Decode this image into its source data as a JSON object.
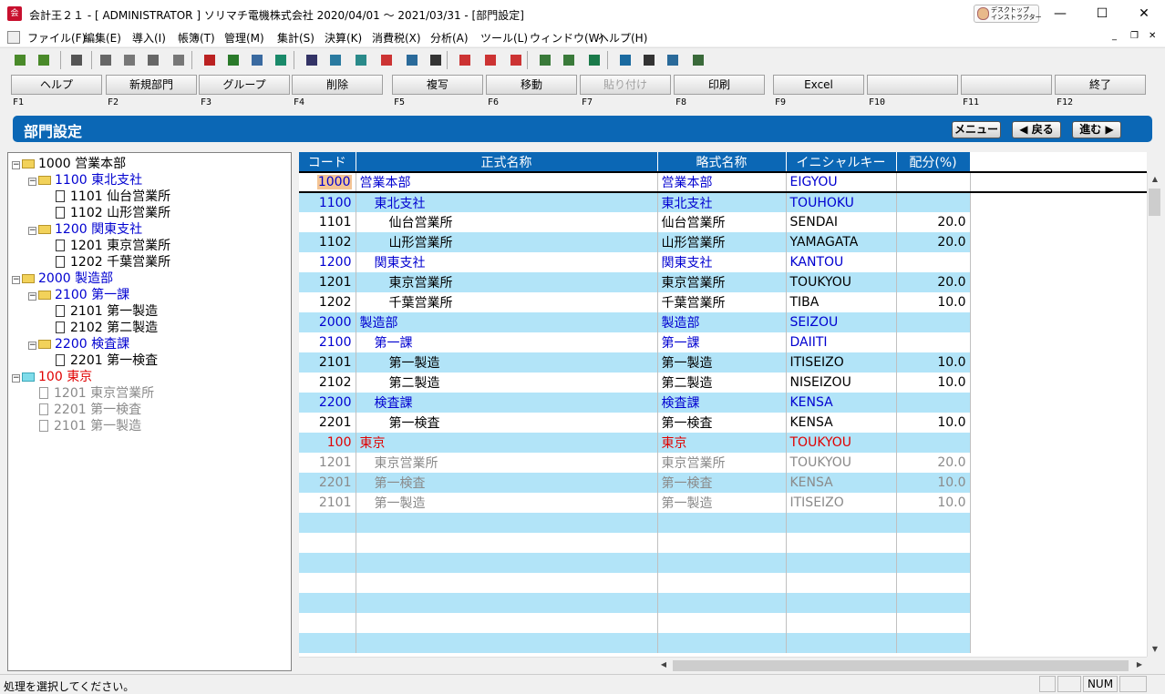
{
  "window": {
    "app_icon": "会",
    "title": "会計王２１ - [ ADMINISTRATOR ] ソリマチ電機株式会社 2020/04/01 〜 2021/03/31 - [部門設定]",
    "desktop_instructor": [
      "デスクトップ",
      "インストラクター"
    ],
    "minimize": "—",
    "maximize": "☐",
    "close": "✕"
  },
  "menu": [
    "ファイル(F)",
    "編集(E)",
    "導入(I)",
    "帳簿(T)",
    "管理(M)",
    "集計(S)",
    "決算(K)",
    "消費税(X)",
    "分析(A)",
    "ツール(L)",
    "ウィンドウ(W)",
    "ヘルプ(H)"
  ],
  "mdi_controls": [
    "_",
    "❐",
    "✕"
  ],
  "toolbar_icons": [
    "import-icon",
    "export-icon",
    "select-icon",
    "cut-icon",
    "copy-icon",
    "paste-icon",
    "clipboard-icon",
    "book-icon",
    "ledger-icon",
    "journal-icon",
    "heart-icon",
    "easy-entry-icon",
    "keyboard-icon",
    "bank-icon",
    "exp-icon",
    "transfer-icon",
    "calendar-icon",
    "stop-icon",
    "schedule-icon",
    "delete-schedule-icon",
    "report-icon",
    "report2-icon",
    "excel-icon",
    "help-icon",
    "layers-icon",
    "globe-icon",
    "calculator-icon"
  ],
  "fkeys": [
    {
      "label": "ヘルプ",
      "key": "F1",
      "enabled": true
    },
    {
      "label": "新規部門",
      "key": "F2",
      "enabled": true
    },
    {
      "label": "グループ",
      "key": "F3",
      "enabled": true
    },
    {
      "label": "削除",
      "key": "F4",
      "enabled": true
    },
    {
      "label": "複写",
      "key": "F5",
      "enabled": true
    },
    {
      "label": "移動",
      "key": "F6",
      "enabled": true
    },
    {
      "label": "貼り付け",
      "key": "F7",
      "enabled": false
    },
    {
      "label": "印刷",
      "key": "F8",
      "enabled": true
    },
    {
      "label": "Excel",
      "key": "F9",
      "enabled": true
    },
    {
      "label": "",
      "key": "F10",
      "enabled": true
    },
    {
      "label": "",
      "key": "F11",
      "enabled": true
    },
    {
      "label": "終了",
      "key": "F12",
      "enabled": true
    }
  ],
  "section": {
    "title": "部門設定",
    "menu_btn": "メニュー",
    "back_btn": "◀ 戻る",
    "next_btn": "進む ▶"
  },
  "tree": [
    {
      "level": 0,
      "kind": "folder",
      "expander": "−",
      "code": "1000",
      "name": "営業本部",
      "color": "blk"
    },
    {
      "level": 1,
      "kind": "folder",
      "expander": "−",
      "code": "1100",
      "name": "東北支社",
      "color": "blue"
    },
    {
      "level": 2,
      "kind": "doc",
      "expander": "",
      "code": "1101",
      "name": "仙台営業所",
      "color": "blk"
    },
    {
      "level": 2,
      "kind": "doc",
      "expander": "",
      "code": "1102",
      "name": "山形営業所",
      "color": "blk"
    },
    {
      "level": 1,
      "kind": "folder",
      "expander": "−",
      "code": "1200",
      "name": "関東支社",
      "color": "blue"
    },
    {
      "level": 2,
      "kind": "doc",
      "expander": "",
      "code": "1201",
      "name": "東京営業所",
      "color": "blk"
    },
    {
      "level": 2,
      "kind": "doc",
      "expander": "",
      "code": "1202",
      "name": "千葉営業所",
      "color": "blk"
    },
    {
      "level": 0,
      "kind": "folder",
      "expander": "−",
      "code": "2000",
      "name": "製造部",
      "color": "blue"
    },
    {
      "level": 1,
      "kind": "folder",
      "expander": "−",
      "code": "2100",
      "name": "第一課",
      "color": "blue"
    },
    {
      "level": 2,
      "kind": "doc",
      "expander": "",
      "code": "2101",
      "name": "第一製造",
      "color": "blk"
    },
    {
      "level": 2,
      "kind": "doc",
      "expander": "",
      "code": "2102",
      "name": "第二製造",
      "color": "blk"
    },
    {
      "level": 1,
      "kind": "folder",
      "expander": "−",
      "code": "2200",
      "name": "検査課",
      "color": "blue"
    },
    {
      "level": 2,
      "kind": "doc",
      "expander": "",
      "code": "2201",
      "name": "第一検査",
      "color": "blk"
    },
    {
      "level": 0,
      "kind": "cyanfolder",
      "expander": "−",
      "code": "100",
      "name": "東京",
      "color": "red"
    },
    {
      "level": 1,
      "kind": "docgray",
      "expander": "",
      "code": "1201",
      "name": "東京営業所",
      "color": "gray"
    },
    {
      "level": 1,
      "kind": "docgray",
      "expander": "",
      "code": "2201",
      "name": "第一検査",
      "color": "gray"
    },
    {
      "level": 1,
      "kind": "docgray",
      "expander": "",
      "code": "2101",
      "name": "第一製造",
      "color": "gray"
    }
  ],
  "grid": {
    "headers": [
      "コード",
      "正式名称",
      "略式名称",
      "イニシャルキー",
      "配分(%)"
    ],
    "rows": [
      {
        "code": "1000",
        "name": "営業本部",
        "indent": 0,
        "short": "営業本部",
        "key": "EIGYOU",
        "pct": "",
        "color": "blue",
        "selected": true
      },
      {
        "code": "1100",
        "name": "東北支社",
        "indent": 1,
        "short": "東北支社",
        "key": "TOUHOKU",
        "pct": "",
        "color": "blue"
      },
      {
        "code": "1101",
        "name": "仙台営業所",
        "indent": 2,
        "short": "仙台営業所",
        "key": "SENDAI",
        "pct": "20.0",
        "color": "blk"
      },
      {
        "code": "1102",
        "name": "山形営業所",
        "indent": 2,
        "short": "山形営業所",
        "key": "YAMAGATA",
        "pct": "20.0",
        "color": "blk"
      },
      {
        "code": "1200",
        "name": "関東支社",
        "indent": 1,
        "short": "関東支社",
        "key": "KANTOU",
        "pct": "",
        "color": "blue"
      },
      {
        "code": "1201",
        "name": "東京営業所",
        "indent": 2,
        "short": "東京営業所",
        "key": "TOUKYOU",
        "pct": "20.0",
        "color": "blk"
      },
      {
        "code": "1202",
        "name": "千葉営業所",
        "indent": 2,
        "short": "千葉営業所",
        "key": "TIBA",
        "pct": "10.0",
        "color": "blk"
      },
      {
        "code": "2000",
        "name": "製造部",
        "indent": 0,
        "short": "製造部",
        "key": "SEIZOU",
        "pct": "",
        "color": "blue"
      },
      {
        "code": "2100",
        "name": "第一課",
        "indent": 1,
        "short": "第一課",
        "key": "DAIITI",
        "pct": "",
        "color": "blue"
      },
      {
        "code": "2101",
        "name": "第一製造",
        "indent": 2,
        "short": "第一製造",
        "key": "ITISEIZO",
        "pct": "10.0",
        "color": "blk"
      },
      {
        "code": "2102",
        "name": "第二製造",
        "indent": 2,
        "short": "第二製造",
        "key": "NISEIZOU",
        "pct": "10.0",
        "color": "blk"
      },
      {
        "code": "2200",
        "name": "検査課",
        "indent": 1,
        "short": "検査課",
        "key": "KENSA",
        "pct": "",
        "color": "blue"
      },
      {
        "code": "2201",
        "name": "第一検査",
        "indent": 2,
        "short": "第一検査",
        "key": "KENSA",
        "pct": "10.0",
        "color": "blk"
      },
      {
        "code": "100",
        "name": "東京",
        "indent": 0,
        "short": "東京",
        "key": "TOUKYOU",
        "pct": "",
        "color": "red"
      },
      {
        "code": "1201",
        "name": "東京営業所",
        "indent": 1,
        "short": "東京営業所",
        "key": "TOUKYOU",
        "pct": "20.0",
        "color": "gray"
      },
      {
        "code": "2201",
        "name": "第一検査",
        "indent": 1,
        "short": "第一検査",
        "key": "KENSA",
        "pct": "10.0",
        "color": "gray"
      },
      {
        "code": "2101",
        "name": "第一製造",
        "indent": 1,
        "short": "第一製造",
        "key": "ITISEIZO",
        "pct": "10.0",
        "color": "gray"
      }
    ],
    "empty_rows": 7
  },
  "statusbar": {
    "text": "処理を選択してください。",
    "num": "NUM"
  },
  "colors": {
    "accent": "#0b67b5",
    "row_alt": "#b2e4f8",
    "blue_text": "#0000d0",
    "red_text": "#e00000",
    "gray_text": "#8a8a8a"
  }
}
